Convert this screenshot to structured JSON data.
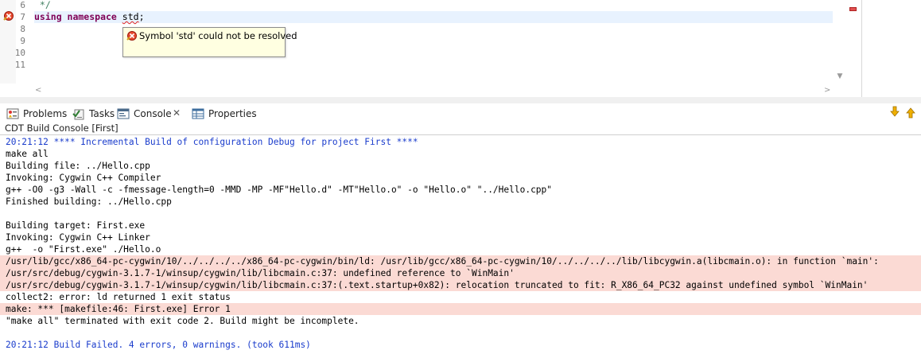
{
  "editor": {
    "lines": [
      {
        "number": "6",
        "text": " */"
      },
      {
        "number": "7",
        "keyword": "using namespace",
        "rest_before": " ",
        "error_token": "std",
        "rest_after": ";"
      },
      {
        "number": "8",
        "text": ""
      },
      {
        "number": "9",
        "text": ""
      },
      {
        "number": "10",
        "text": ""
      },
      {
        "number": "11",
        "text": ""
      }
    ],
    "tooltip": "Symbol 'std' could not be resolved"
  },
  "tabs": [
    {
      "label": "Problems",
      "icon": "problems-icon"
    },
    {
      "label": "Tasks",
      "icon": "tasks-icon"
    },
    {
      "label": "Console",
      "icon": "console-icon"
    },
    {
      "label": "Properties",
      "icon": "properties-icon"
    }
  ],
  "console": {
    "title": "CDT Build Console [First]",
    "lines": [
      {
        "text": "20:21:12 **** Incremental Build of configuration Debug for project First ****",
        "kind": "info"
      },
      {
        "text": "make all",
        "kind": "normal"
      },
      {
        "text": "Building file: ../Hello.cpp",
        "kind": "normal"
      },
      {
        "text": "Invoking: Cygwin C++ Compiler",
        "kind": "normal"
      },
      {
        "text": "g++ -O0 -g3 -Wall -c -fmessage-length=0 -MMD -MP -MF\"Hello.d\" -MT\"Hello.o\" -o \"Hello.o\" \"../Hello.cpp\"",
        "kind": "normal"
      },
      {
        "text": "Finished building: ../Hello.cpp",
        "kind": "normal"
      },
      {
        "text": "",
        "kind": "normal"
      },
      {
        "text": "Building target: First.exe",
        "kind": "normal"
      },
      {
        "text": "Invoking: Cygwin C++ Linker",
        "kind": "normal"
      },
      {
        "text": "g++  -o \"First.exe\" ./Hello.o",
        "kind": "normal"
      },
      {
        "text": "/usr/lib/gcc/x86_64-pc-cygwin/10/../../../../x86_64-pc-cygwin/bin/ld: /usr/lib/gcc/x86_64-pc-cygwin/10/../../../../lib/libcygwin.a(libcmain.o): in function `main':",
        "kind": "error"
      },
      {
        "text": "/usr/src/debug/cygwin-3.1.7-1/winsup/cygwin/lib/libcmain.c:37: undefined reference to `WinMain'",
        "kind": "error"
      },
      {
        "text": "/usr/src/debug/cygwin-3.1.7-1/winsup/cygwin/lib/libcmain.c:37:(.text.startup+0x82): relocation truncated to fit: R_X86_64_PC32 against undefined symbol `WinMain'",
        "kind": "error"
      },
      {
        "text": "collect2: error: ld returned 1 exit status",
        "kind": "normal"
      },
      {
        "text": "make: *** [makefile:46: First.exe] Error 1",
        "kind": "error"
      },
      {
        "text": "\"make all\" terminated with exit code 2. Build might be incomplete.",
        "kind": "normal"
      },
      {
        "text": "",
        "kind": "normal"
      },
      {
        "text": "20:21:12 Build Failed. 4 errors, 0 warnings. (took 611ms)",
        "kind": "info"
      }
    ]
  },
  "colors": {
    "keyword": "#7f0055",
    "comment": "#3f7f5f",
    "info_text": "#1a3ccc",
    "error_line_bg": "#fbdad4",
    "current_line_bg": "#e8f2fe",
    "tooltip_bg": "#ffffe1"
  }
}
